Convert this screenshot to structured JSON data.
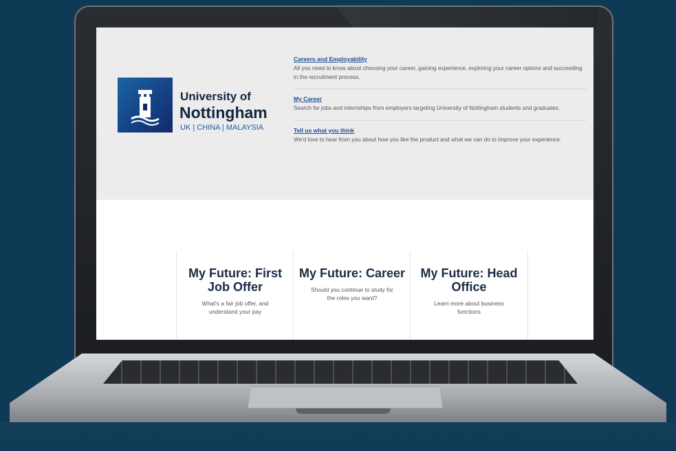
{
  "brand": {
    "line1": "University of",
    "line2": "Nottingham",
    "line3": "UK | CHINA | MALAYSIA"
  },
  "links": [
    {
      "title": "Careers and Employability",
      "desc": "All you need to know about choosing your career, gaining experience, exploring your career options and succeeding in the recruitment process."
    },
    {
      "title": "My Career",
      "desc": "Search for jobs and internships from employers targeting University of Nottingham students and graduates."
    },
    {
      "title": "Tell us what you think",
      "desc": "We'd love to hear from you about how you like the product and what we can do to improve your experience."
    }
  ],
  "cards": [
    {
      "title": "My Future: First Job Offer",
      "desc": "What's a fair job offer, and understand your pay"
    },
    {
      "title": "My Future: Career",
      "desc": "Should you continue to study for the roles you want?"
    },
    {
      "title": "My Future: Head Office",
      "desc": "Learn more about business functions"
    }
  ],
  "colors": {
    "background": "#0e3a55",
    "link": "#1a4e98",
    "brand_blue": "#12296b",
    "accent_red": "#e7424a"
  },
  "icons": [
    "university-crest-icon"
  ]
}
